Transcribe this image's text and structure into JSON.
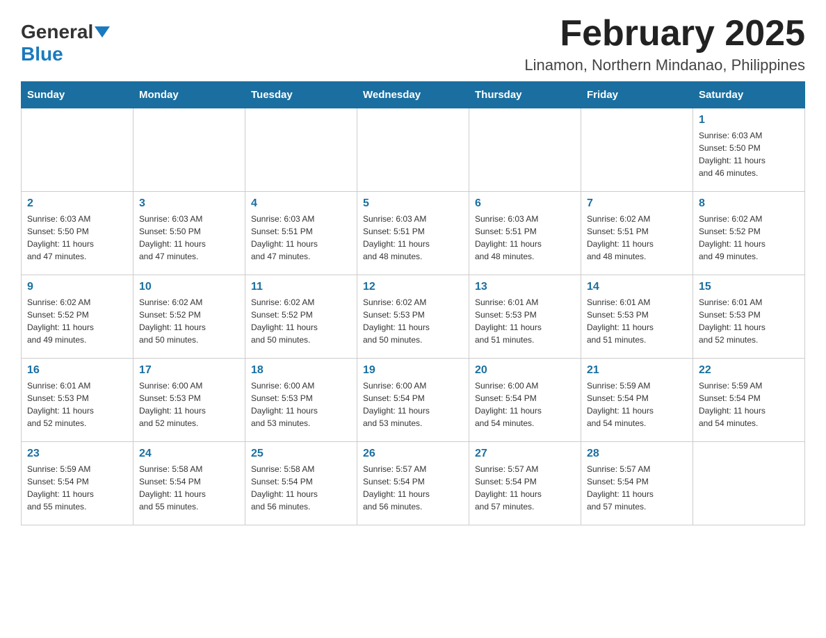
{
  "logo": {
    "general": "General",
    "blue": "Blue"
  },
  "header": {
    "month_title": "February 2025",
    "location": "Linamon, Northern Mindanao, Philippines"
  },
  "weekdays": [
    "Sunday",
    "Monday",
    "Tuesday",
    "Wednesday",
    "Thursday",
    "Friday",
    "Saturday"
  ],
  "weeks": [
    [
      {
        "day": "",
        "info": ""
      },
      {
        "day": "",
        "info": ""
      },
      {
        "day": "",
        "info": ""
      },
      {
        "day": "",
        "info": ""
      },
      {
        "day": "",
        "info": ""
      },
      {
        "day": "",
        "info": ""
      },
      {
        "day": "1",
        "info": "Sunrise: 6:03 AM\nSunset: 5:50 PM\nDaylight: 11 hours\nand 46 minutes."
      }
    ],
    [
      {
        "day": "2",
        "info": "Sunrise: 6:03 AM\nSunset: 5:50 PM\nDaylight: 11 hours\nand 47 minutes."
      },
      {
        "day": "3",
        "info": "Sunrise: 6:03 AM\nSunset: 5:50 PM\nDaylight: 11 hours\nand 47 minutes."
      },
      {
        "day": "4",
        "info": "Sunrise: 6:03 AM\nSunset: 5:51 PM\nDaylight: 11 hours\nand 47 minutes."
      },
      {
        "day": "5",
        "info": "Sunrise: 6:03 AM\nSunset: 5:51 PM\nDaylight: 11 hours\nand 48 minutes."
      },
      {
        "day": "6",
        "info": "Sunrise: 6:03 AM\nSunset: 5:51 PM\nDaylight: 11 hours\nand 48 minutes."
      },
      {
        "day": "7",
        "info": "Sunrise: 6:02 AM\nSunset: 5:51 PM\nDaylight: 11 hours\nand 48 minutes."
      },
      {
        "day": "8",
        "info": "Sunrise: 6:02 AM\nSunset: 5:52 PM\nDaylight: 11 hours\nand 49 minutes."
      }
    ],
    [
      {
        "day": "9",
        "info": "Sunrise: 6:02 AM\nSunset: 5:52 PM\nDaylight: 11 hours\nand 49 minutes."
      },
      {
        "day": "10",
        "info": "Sunrise: 6:02 AM\nSunset: 5:52 PM\nDaylight: 11 hours\nand 50 minutes."
      },
      {
        "day": "11",
        "info": "Sunrise: 6:02 AM\nSunset: 5:52 PM\nDaylight: 11 hours\nand 50 minutes."
      },
      {
        "day": "12",
        "info": "Sunrise: 6:02 AM\nSunset: 5:53 PM\nDaylight: 11 hours\nand 50 minutes."
      },
      {
        "day": "13",
        "info": "Sunrise: 6:01 AM\nSunset: 5:53 PM\nDaylight: 11 hours\nand 51 minutes."
      },
      {
        "day": "14",
        "info": "Sunrise: 6:01 AM\nSunset: 5:53 PM\nDaylight: 11 hours\nand 51 minutes."
      },
      {
        "day": "15",
        "info": "Sunrise: 6:01 AM\nSunset: 5:53 PM\nDaylight: 11 hours\nand 52 minutes."
      }
    ],
    [
      {
        "day": "16",
        "info": "Sunrise: 6:01 AM\nSunset: 5:53 PM\nDaylight: 11 hours\nand 52 minutes."
      },
      {
        "day": "17",
        "info": "Sunrise: 6:00 AM\nSunset: 5:53 PM\nDaylight: 11 hours\nand 52 minutes."
      },
      {
        "day": "18",
        "info": "Sunrise: 6:00 AM\nSunset: 5:53 PM\nDaylight: 11 hours\nand 53 minutes."
      },
      {
        "day": "19",
        "info": "Sunrise: 6:00 AM\nSunset: 5:54 PM\nDaylight: 11 hours\nand 53 minutes."
      },
      {
        "day": "20",
        "info": "Sunrise: 6:00 AM\nSunset: 5:54 PM\nDaylight: 11 hours\nand 54 minutes."
      },
      {
        "day": "21",
        "info": "Sunrise: 5:59 AM\nSunset: 5:54 PM\nDaylight: 11 hours\nand 54 minutes."
      },
      {
        "day": "22",
        "info": "Sunrise: 5:59 AM\nSunset: 5:54 PM\nDaylight: 11 hours\nand 54 minutes."
      }
    ],
    [
      {
        "day": "23",
        "info": "Sunrise: 5:59 AM\nSunset: 5:54 PM\nDaylight: 11 hours\nand 55 minutes."
      },
      {
        "day": "24",
        "info": "Sunrise: 5:58 AM\nSunset: 5:54 PM\nDaylight: 11 hours\nand 55 minutes."
      },
      {
        "day": "25",
        "info": "Sunrise: 5:58 AM\nSunset: 5:54 PM\nDaylight: 11 hours\nand 56 minutes."
      },
      {
        "day": "26",
        "info": "Sunrise: 5:57 AM\nSunset: 5:54 PM\nDaylight: 11 hours\nand 56 minutes."
      },
      {
        "day": "27",
        "info": "Sunrise: 5:57 AM\nSunset: 5:54 PM\nDaylight: 11 hours\nand 57 minutes."
      },
      {
        "day": "28",
        "info": "Sunrise: 5:57 AM\nSunset: 5:54 PM\nDaylight: 11 hours\nand 57 minutes."
      },
      {
        "day": "",
        "info": ""
      }
    ]
  ]
}
